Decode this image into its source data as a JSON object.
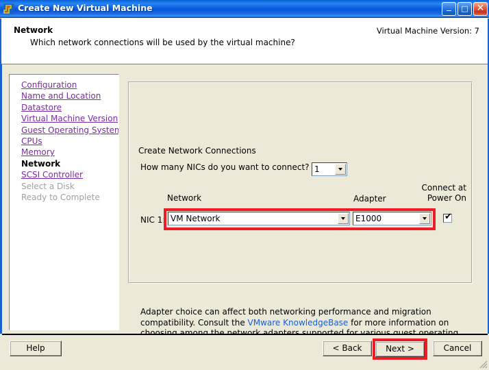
{
  "window": {
    "title": "Create New Virtual Machine",
    "icon": "vm-window-icon",
    "controls": {
      "minimize_label": "_",
      "maximize_label": "□",
      "close_label": "✕"
    }
  },
  "header": {
    "title": "Network",
    "subtitle": "Which network connections will be used by the virtual machine?",
    "version": "Virtual Machine Version: 7"
  },
  "sidebar": {
    "items": [
      {
        "label": "Configuration",
        "state": "link"
      },
      {
        "label": "Name and Location",
        "state": "link"
      },
      {
        "label": "Datastore",
        "state": "link"
      },
      {
        "label": "Virtual Machine Version",
        "state": "link"
      },
      {
        "label": "Guest Operating System",
        "state": "link"
      },
      {
        "label": "CPUs",
        "state": "link"
      },
      {
        "label": "Memory",
        "state": "link"
      },
      {
        "label": "Network",
        "state": "current"
      },
      {
        "label": "SCSI Controller",
        "state": "link"
      },
      {
        "label": "Select a Disk",
        "state": "disabled"
      },
      {
        "label": "Ready to Complete",
        "state": "disabled"
      }
    ]
  },
  "main": {
    "groupbox_legend": "Create Network Connections",
    "nic_count_label": "How many NICs do you want to connect?",
    "nic_count_value": "1",
    "columns": {
      "network": "Network",
      "adapter": "Adapter",
      "connect_at_power_on_line1": "Connect at",
      "connect_at_power_on_line2": "Power On"
    },
    "nic_row": {
      "label": "NIC 1:",
      "network_value": "VM Network",
      "adapter_value": "E1000",
      "connect_at_power_on_checked": true
    },
    "helper_note": {
      "text_before": "Adapter choice can affect both networking performance and migration compatibility. Consult the ",
      "link_text": "VMware KnowledgeBase",
      "text_after": " for more information on choosing among the network adapters supported for various guest operating systems and hosts."
    }
  },
  "footer": {
    "help_label": "Help",
    "back_label": "< Back",
    "next_label": "Next >",
    "cancel_label": "Cancel"
  },
  "highlights": {
    "color": "#ee1c24",
    "targets": [
      "nic-row",
      "next-button"
    ]
  }
}
